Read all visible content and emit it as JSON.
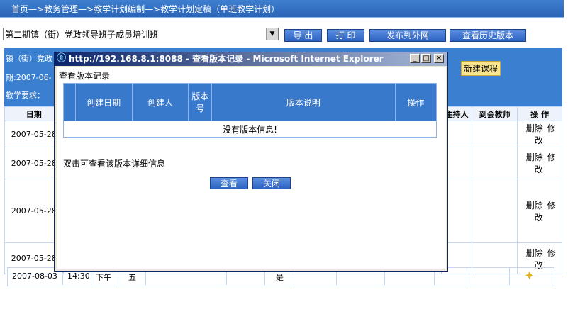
{
  "breadcrumb": "首页—>教务管理—>教学计划编制—>教学计划定稿（单班教学计划）",
  "toolbar": {
    "class_select": "第二期镇（街）党政领导班子成员培训班",
    "export_label": "导 出",
    "print_label": "打 印",
    "publish_label": "发布到外网",
    "history_label": "查看历史版本"
  },
  "panel": {
    "line1": "镇（街）党政",
    "line2": "期:2007-06-",
    "line3": "教学要求：",
    "new_course_label": "新建课程"
  },
  "schedule": {
    "headers": [
      "日期",
      "主持人",
      "到会教师",
      "操 作"
    ],
    "rows": [
      {
        "date": "2007-05-28",
        "delete": "删除",
        "edit": "修改"
      },
      {
        "date": "2007-05-28",
        "delete": "删除",
        "edit": "修改"
      },
      {
        "date": "2007-05-28",
        "delete": "删除",
        "edit": "修改"
      },
      {
        "date": "2007-05-28",
        "delete": "删除",
        "edit": "修改"
      }
    ],
    "last_row": {
      "date": "2007-08-03",
      "time": "14:30",
      "period": "下午",
      "weekday": "五",
      "flag": "是"
    }
  },
  "dialog": {
    "title": "http://192.168.8.1:8088 - 查看版本记录 - Microsoft Internet Explorer",
    "heading": "查看版本记录",
    "columns": [
      "创建日期",
      "创建人",
      "版本号",
      "版本说明",
      "操作"
    ],
    "empty_message": "没有版本信息!",
    "hint": "双击可查看该版本详细信息",
    "view_label": "查看",
    "close_label": "关闭"
  },
  "colors": {
    "accent": "#3b80d0",
    "title_bar": "#0a246a"
  }
}
